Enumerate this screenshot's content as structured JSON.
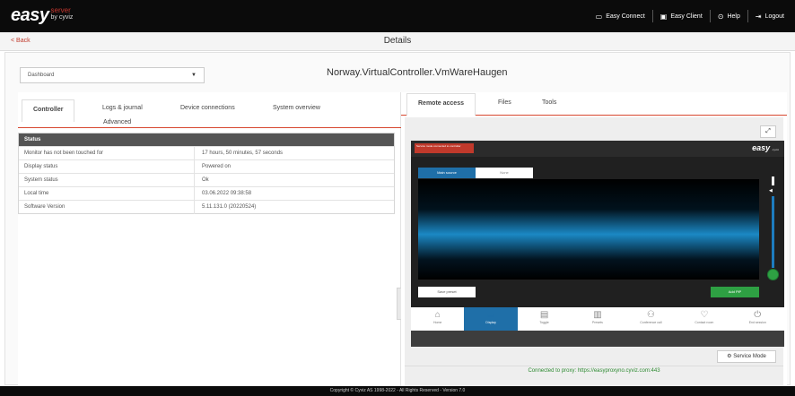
{
  "app": {
    "logo": "easy",
    "logo_tag": "server",
    "logo_sub": "by cyviz",
    "footer": "Copyright © Cyviz AS 1998-2022 - All Rights Reserved - Version 7.0"
  },
  "topnav": [
    {
      "label": "Easy Connect",
      "icon": "connect-icon",
      "glyph": "▭"
    },
    {
      "label": "Easy Client",
      "icon": "client-icon",
      "glyph": "▣"
    },
    {
      "label": "Help",
      "icon": "help-icon",
      "glyph": "⊙"
    },
    {
      "label": "Logout",
      "icon": "logout-icon",
      "glyph": "⇥"
    }
  ],
  "subbar": {
    "back": "< Back",
    "title": "Details"
  },
  "dashboard": {
    "selected": "Dashboard",
    "caret": "▼"
  },
  "controller_name": "Norway.VirtualController.VmWareHaugen",
  "left_tabs": [
    "Controller",
    "Logs & journal",
    "Device connections",
    "System overview",
    "Advanced"
  ],
  "status": {
    "header": "Status",
    "rows": [
      {
        "key": "Monitor has not been touched for",
        "value": "17 hours, 50 minutes, 57 seconds"
      },
      {
        "key": "Display status",
        "value": "Powered on"
      },
      {
        "key": "System status",
        "value": "Ok"
      },
      {
        "key": "Local time",
        "value": "03.06.2022 09:38:58"
      },
      {
        "key": "Software Version",
        "value": "5.11.131.0 (20220524)"
      }
    ]
  },
  "right_tabs": [
    "Remote access",
    "Files",
    "Tools"
  ],
  "remote": {
    "badge": "Service mode connected to controller",
    "logo": "easy",
    "logo_sub": "cyviz",
    "source_tabs": [
      "Main source",
      "None"
    ],
    "save_preset": "Save preset",
    "add_pip": "Add PiP",
    "nav": [
      {
        "label": "Home",
        "glyph": "⌂"
      },
      {
        "label": "Display",
        "glyph": "▭"
      },
      {
        "label": "Toggle",
        "glyph": "▤"
      },
      {
        "label": "Presets",
        "glyph": "▥"
      },
      {
        "label": "Conference call",
        "glyph": "⚇"
      },
      {
        "label": "Contact room",
        "glyph": "♡"
      },
      {
        "label": "End session",
        "glyph": "⏻"
      }
    ]
  },
  "expand_glyph": "⤢",
  "service_mode": "Service Mode",
  "service_glyph": "⚙",
  "proxy": "Connected to proxy: https://easyproxyno.cyviz.com:443"
}
